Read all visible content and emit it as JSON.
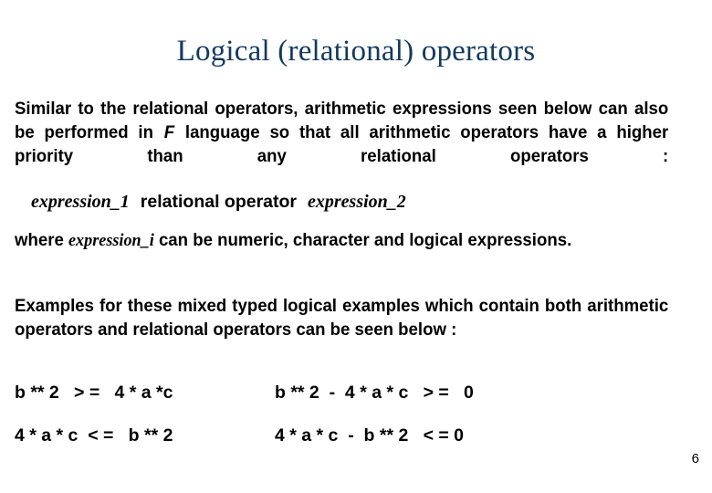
{
  "slide": {
    "title": "Logical (relational) operators",
    "title_color": "#123a5e",
    "background_color": "#ffffff",
    "text_color": "#000000",
    "page_number": "6"
  },
  "paragraphs": {
    "intro": {
      "part1": "Similar to the relational operators, arithmetic expressions seen below  can also be performed in ",
      "emphasis": "F",
      "part2": " language so that all arithmetic operators have a higher priority than any relational operators :"
    },
    "syntax": {
      "expression_1": "expression_1",
      "operator": "relational operator",
      "expression_2": "expression_2"
    },
    "where": {
      "part1": "where  ",
      "emphasis": "expression_i",
      "part2": "  can   be   numeric,  character  and  logical expressions."
    },
    "examples_intro": "Examples for these mixed typed logical examples which contain both arithmetic operators and relational operators can be seen below :"
  },
  "examples": {
    "rows": [
      {
        "left": "b ** 2   > =   4 * a *c",
        "right": "b ** 2  -  4 * a * c   > =   0"
      },
      {
        "left": "4 * a * c  < =   b ** 2",
        "right": "4 * a * c  -  b ** 2   < = 0"
      }
    ]
  }
}
